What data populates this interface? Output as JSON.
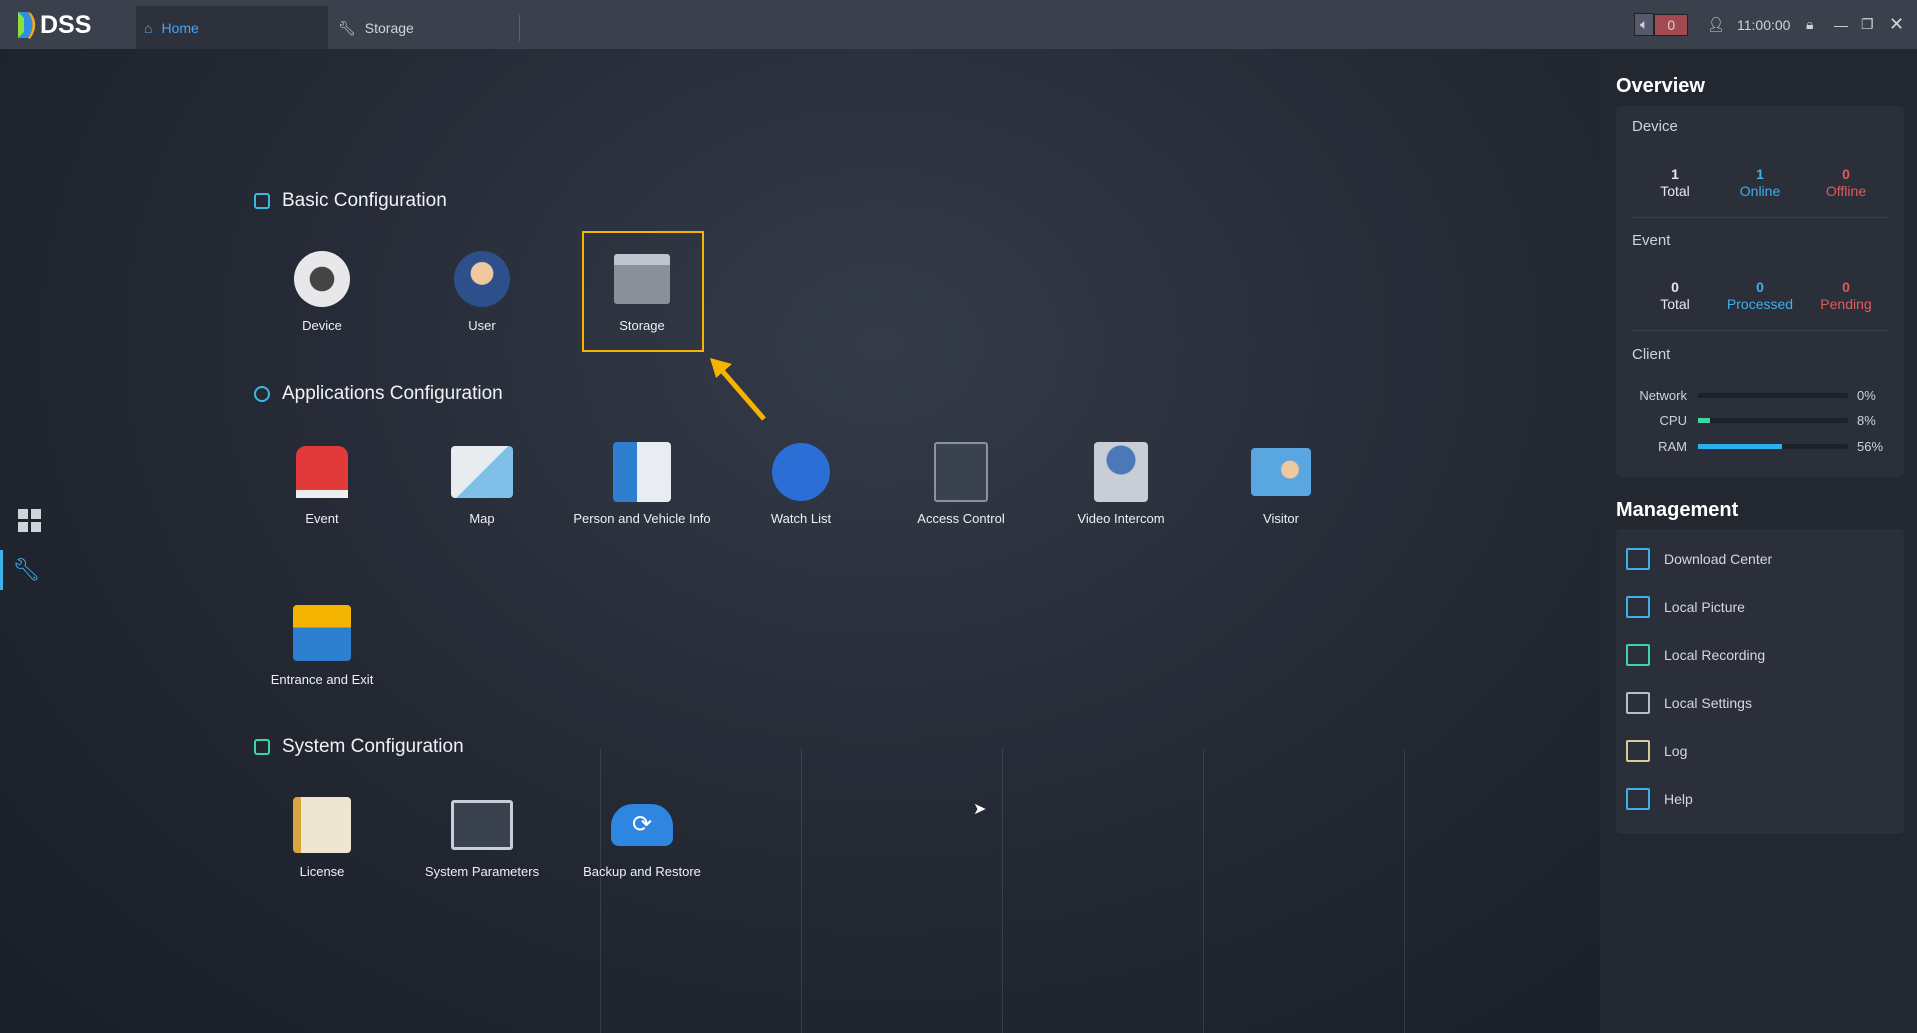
{
  "app": {
    "logo": "DSS"
  },
  "tabs": [
    {
      "label": "Home",
      "icon": "home-icon"
    },
    {
      "label": "Storage",
      "icon": "wrench-icon"
    }
  ],
  "topbar": {
    "alarm_count": "0",
    "time": "11:00:00"
  },
  "sections": {
    "basic": {
      "title": "Basic Configuration",
      "items": [
        "Device",
        "User",
        "Storage"
      ]
    },
    "apps": {
      "title": "Applications Configuration",
      "items": [
        "Event",
        "Map",
        "Person and Vehicle Info",
        "Watch List",
        "Access Control",
        "Video Intercom",
        "Visitor",
        "Entrance and Exit"
      ]
    },
    "system": {
      "title": "System Configuration",
      "items": [
        "License",
        "System Parameters",
        "Backup and Restore"
      ]
    }
  },
  "overview": {
    "title": "Overview",
    "device": {
      "title": "Device",
      "total": "1",
      "total_label": "Total",
      "online": "1",
      "online_label": "Online",
      "offline": "0",
      "offline_label": "Offline"
    },
    "event": {
      "title": "Event",
      "total": "0",
      "total_label": "Total",
      "processed": "0",
      "processed_label": "Processed",
      "pending": "0",
      "pending_label": "Pending"
    },
    "client": {
      "title": "Client",
      "network_label": "Network",
      "network": "0%",
      "network_value": 0,
      "cpu_label": "CPU",
      "cpu": "8%",
      "cpu_value": 8,
      "ram_label": "RAM",
      "ram": "56%",
      "ram_value": 56
    }
  },
  "management": {
    "title": "Management",
    "items": [
      "Download Center",
      "Local Picture",
      "Local Recording",
      "Local Settings",
      "Log",
      "Help"
    ]
  },
  "colors": {
    "accent": "#3fb0ec",
    "alert": "#e25b5b",
    "highlight": "#f5b400",
    "cpu": "#3ed6a0"
  }
}
